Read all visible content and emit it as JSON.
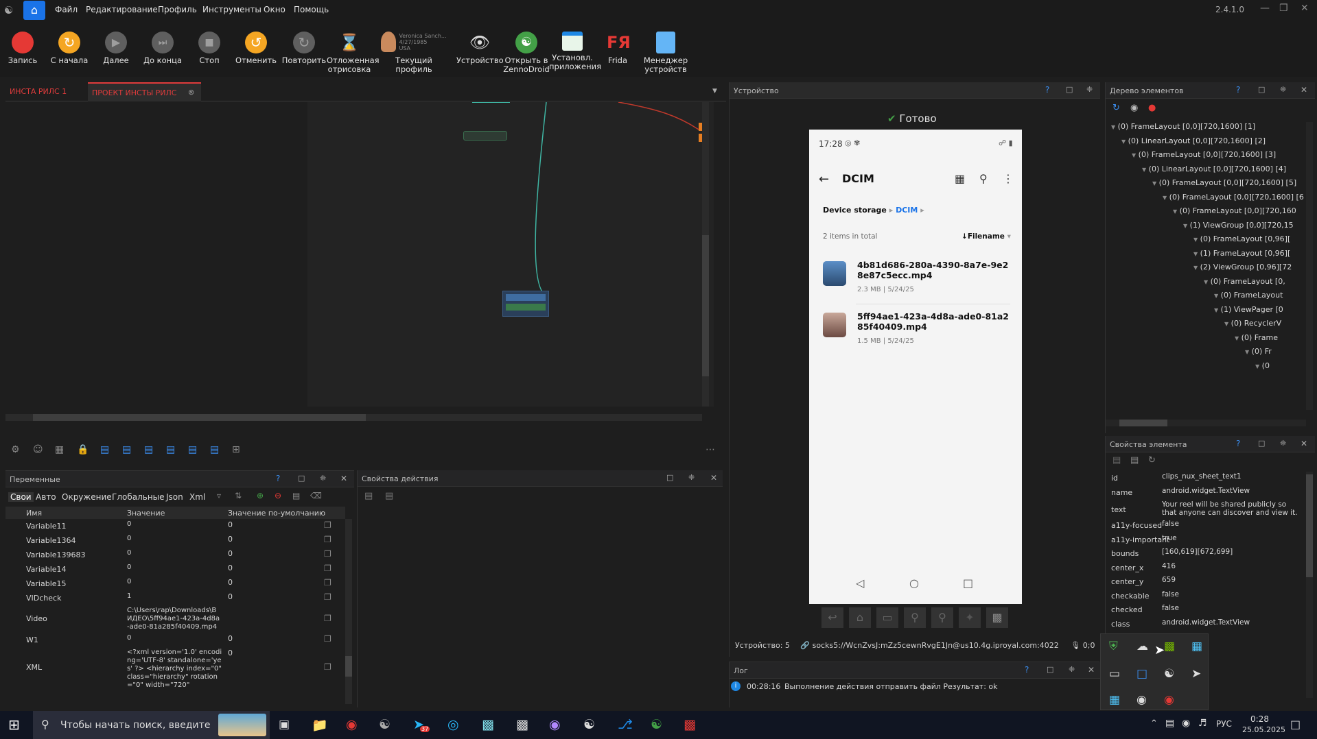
{
  "menubar": {
    "items": [
      "Файл",
      "Редактирование",
      "Профиль",
      "Инструменты",
      "Окно",
      "Помощь"
    ],
    "version": "2.4.1.0"
  },
  "toolbar": {
    "buttons": [
      {
        "label": "Запись",
        "icon": "record-icon",
        "color": "#e53935"
      },
      {
        "label": "С начала",
        "icon": "restart-icon",
        "color": "#f5a623"
      },
      {
        "label": "Далее",
        "icon": "play-icon",
        "color": "#757575"
      },
      {
        "label": "До конца",
        "icon": "skip-end-icon",
        "color": "#757575"
      },
      {
        "label": "Стоп",
        "icon": "stop-icon",
        "color": "#757575"
      },
      {
        "label": "Отменить",
        "icon": "undo-icon",
        "color": "#f5a623"
      },
      {
        "label": "Повторить",
        "icon": "redo-icon",
        "color": "#757575"
      },
      {
        "label": "Отложенная отрисовка",
        "icon": "hourglass-icon",
        "color": "#f5a623"
      },
      {
        "label": "Текущий профиль",
        "icon": "profile-icon",
        "color": "#f5a623"
      },
      {
        "label": "Устройство",
        "icon": "eye-icon",
        "color": "#1e88e5"
      },
      {
        "label": "Открыть в ZennoDroid",
        "icon": "zennodroid-icon",
        "color": "#43a047"
      },
      {
        "label": "Установл. приложения",
        "icon": "installed-apps-icon",
        "color": "#4caf50"
      },
      {
        "label": "Frida",
        "icon": "frida-icon",
        "color": "#e53935"
      },
      {
        "label": "Менеджер устройств",
        "icon": "device-manager-icon",
        "color": "#64b5f6"
      }
    ],
    "profile": {
      "name": "Veronica Sanch...",
      "dob": "4/27/1985",
      "country": "USA"
    }
  },
  "project_tabs": {
    "tabs": [
      {
        "label": "ИНСТА РИЛС 1"
      },
      {
        "label": "ПРОЕКТ ИНСТЫ РИЛС"
      }
    ],
    "active": 1,
    "accent": "#e03c3c"
  },
  "variables_panel": {
    "title": "Переменные",
    "tabs": [
      "Свои",
      "Авто",
      "Окружение",
      "Глобальные",
      "Json",
      "Xml"
    ],
    "columns": [
      "Имя",
      "Значение",
      "Значение по-умолчанию"
    ],
    "rows": [
      {
        "name": "Variable11",
        "value": "0",
        "default": "0"
      },
      {
        "name": "Variable1364",
        "value": "0",
        "default": "0"
      },
      {
        "name": "Variable139683",
        "value": "0",
        "default": "0"
      },
      {
        "name": "Variable14",
        "value": "0",
        "default": "0"
      },
      {
        "name": "Variable15",
        "value": "0",
        "default": "0"
      },
      {
        "name": "VIDcheck",
        "value": "1",
        "default": "0"
      },
      {
        "name": "Video",
        "value": "C:\\Users\\rap\\Downloads\\В ИДЕО\\5ff94ae1-423a-4d8a -ade0-81a285f40409.mp4",
        "default": ""
      },
      {
        "name": "W1",
        "value": "0",
        "default": "0"
      },
      {
        "name": "XML",
        "value": "<?xml version='1.0' encoding='UTF-8' standalone='yes' ?> <hierarchy index=\"0\" class=\"hierarchy\" rotation=\"0\" width=\"720\"",
        "default": "0"
      }
    ]
  },
  "action_props_panel": {
    "title": "Свойства действия"
  },
  "device_panel": {
    "title": "Устройство",
    "status": "Готово",
    "footer": {
      "device": "Устройство: 5",
      "proxy": "socks5://WcnZvsJ:mZz5cewnRvgE1Jn@us10.4g.iproyal.com:4022",
      "counter": "0;0"
    },
    "phone": {
      "time": "17:28",
      "folder": "DCIM",
      "breadcrumb": [
        "Device storage",
        "DCIM"
      ],
      "items_count": "2 items in total",
      "sort": "Filename",
      "files": [
        {
          "name": "4b81d686-280a-4390-8a7e-9e28e87c5ecc.mp4",
          "size": "2.3 MB",
          "date": "5/24/25"
        },
        {
          "name": "5ff94ae1-423a-4d8a-ade0-81a285f40409.mp4",
          "size": "1.5 MB",
          "date": "5/24/25"
        }
      ]
    }
  },
  "log_panel": {
    "title": "Лог",
    "entries": [
      {
        "time": "00:28:16",
        "text": "Выполнение действия отправить файл Результат: ok"
      }
    ]
  },
  "tree_panel": {
    "title": "Дерево элементов",
    "nodes": [
      {
        "text": "(0) FrameLayout [0,0][720,1600] [1]",
        "depth": 0
      },
      {
        "text": "(0) LinearLayout [0,0][720,1600] [2]",
        "depth": 1
      },
      {
        "text": "(0) FrameLayout [0,0][720,1600] [3]",
        "depth": 2
      },
      {
        "text": "(0) LinearLayout [0,0][720,1600] [4]",
        "depth": 3
      },
      {
        "text": "(0) FrameLayout [0,0][720,1600] [5]",
        "depth": 4
      },
      {
        "text": "(0) FrameLayout [0,0][720,1600] [6",
        "depth": 5
      },
      {
        "text": "(0) FrameLayout [0,0][720,160",
        "depth": 6
      },
      {
        "text": "(1) ViewGroup [0,0][720,15",
        "depth": 7
      },
      {
        "text": "(0) FrameLayout [0,96][",
        "depth": 8
      },
      {
        "text": "(1) FrameLayout [0,96][",
        "depth": 8
      },
      {
        "text": "(2) ViewGroup [0,96][72",
        "depth": 8
      },
      {
        "text": "(0) FrameLayout [0,",
        "depth": 9
      },
      {
        "text": "(0) FrameLayout",
        "depth": 10
      },
      {
        "text": "(1) ViewPager [0",
        "depth": 10
      },
      {
        "text": "(0) RecyclerV",
        "depth": 11
      },
      {
        "text": "(0) Frame",
        "depth": 12
      },
      {
        "text": "(0) Fr",
        "depth": 13
      },
      {
        "text": "(0",
        "depth": 14
      }
    ]
  },
  "element_props_panel": {
    "title": "Свойства элемента",
    "props": [
      {
        "key": "id",
        "value": "clips_nux_sheet_text1"
      },
      {
        "key": "name",
        "value": "android.widget.TextView"
      },
      {
        "key": "text",
        "value": "Your reel will be shared publicly so that anyone can discover and view it."
      },
      {
        "key": "a11y-focused",
        "value": "false"
      },
      {
        "key": "a11y-important",
        "value": "true"
      },
      {
        "key": "bounds",
        "value": "[160,619][672,699]"
      },
      {
        "key": "center_x",
        "value": "416"
      },
      {
        "key": "center_y",
        "value": "659"
      },
      {
        "key": "checkable",
        "value": "false"
      },
      {
        "key": "checked",
        "value": "false"
      },
      {
        "key": "class",
        "value": "android.widget.TextView"
      }
    ]
  },
  "taskbar": {
    "search_placeholder": "Чтобы начать поиск, введите",
    "lang": "РУС",
    "time": "0:28",
    "date": "25.05.2025",
    "telegram_badge": "37"
  }
}
